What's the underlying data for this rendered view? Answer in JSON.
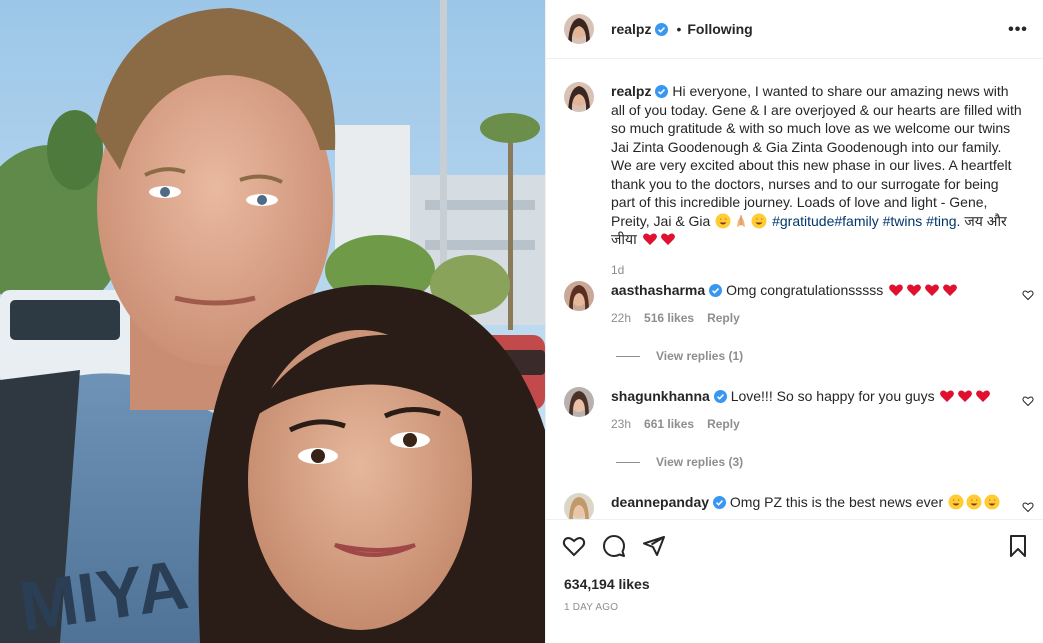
{
  "post": {
    "username": "realpz",
    "follow_status": "Following",
    "more_icon": "more-horizontal-icon"
  },
  "caption": {
    "username": "realpz",
    "text_1": "Hi everyone, I wanted to share our amazing news with all of you today. Gene & I are overjoyed & our hearts are filled with so much gratitude & with so much love as we welcome our twins Jai Zinta Goodenough & Gia Zinta Goodenough into our family. We are very excited about this new phase in our lives. A heartfelt thank you to the doctors, nurses and to our surrogate for being part of this incredible journey. Loads of love and light - Gene, Preity, Jai & Gia",
    "hashtags": "#gratitude#family #twins #ting.",
    "hindi_text": "जय और जीया",
    "time": "1d"
  },
  "comments": [
    {
      "username": "aasthasharma",
      "text": "Omg congratulationsssss",
      "time": "22h",
      "likes": "516 likes",
      "reply_label": "Reply",
      "view_replies": "View replies (1)"
    },
    {
      "username": "shagunkhanna",
      "text": "Love!!! So so happy for you guys",
      "time": "23h",
      "likes": "661 likes",
      "reply_label": "Reply",
      "view_replies": "View replies (3)"
    },
    {
      "username": "deannepanday",
      "text": "Omg PZ this is the best news ever"
    }
  ],
  "footer": {
    "likes": "634,194 likes",
    "posted": "1 DAY AGO"
  },
  "colors": {
    "text": "#262626",
    "muted": "#8e8e8e",
    "link": "#00376b",
    "verified": "#3897f0",
    "heart": "#ed4956"
  }
}
